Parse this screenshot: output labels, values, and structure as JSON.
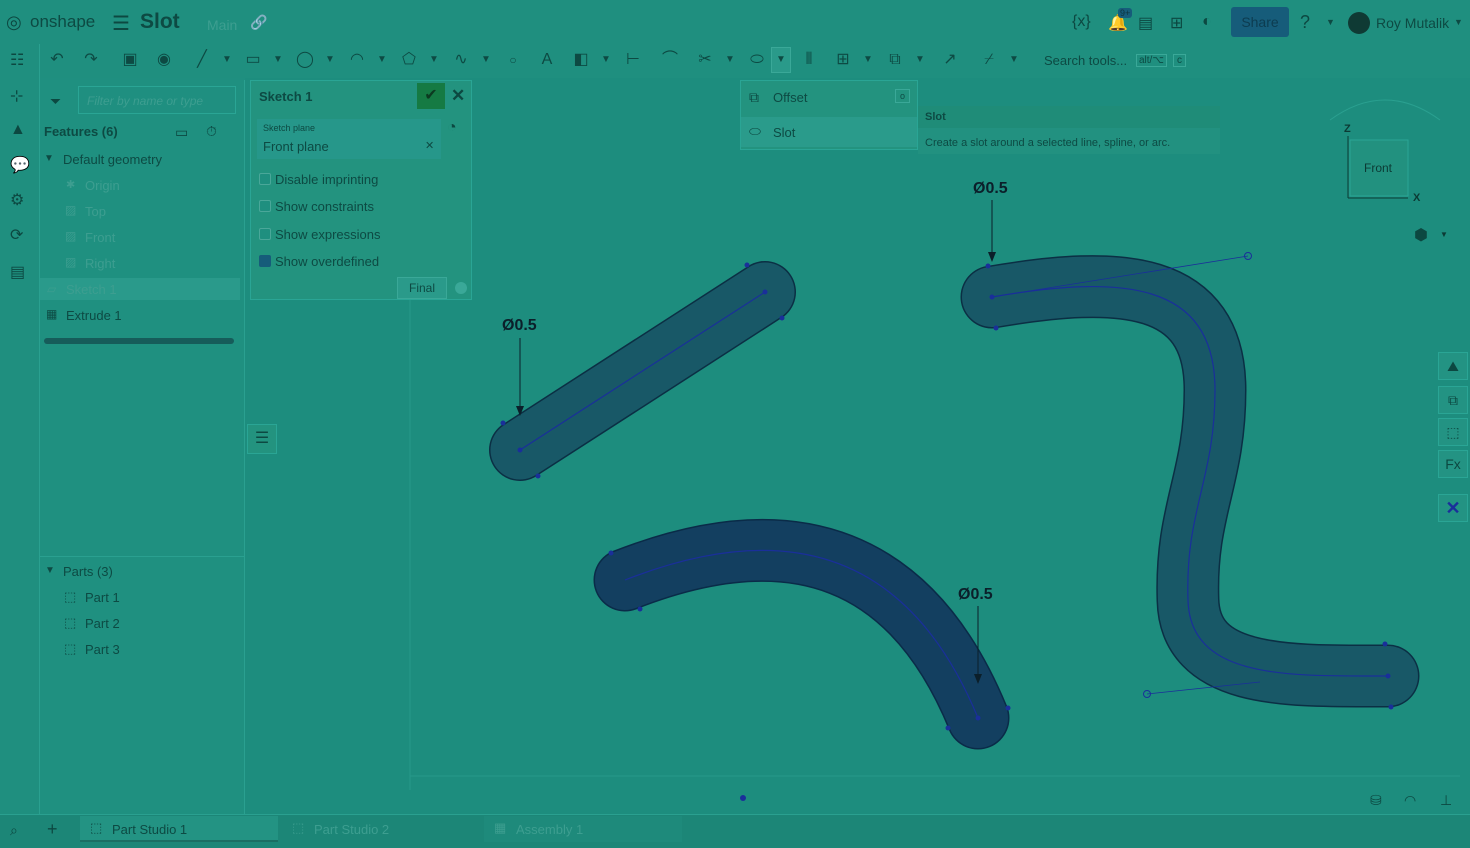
{
  "header": {
    "logo": "onshape",
    "document_title": "Slot",
    "branch": "Main",
    "share_label": "Share",
    "notification_badge": "9+",
    "user_name": "Roy Mutalik"
  },
  "toolbar": {
    "search_placeholder": "Search tools...",
    "search_shortcut_1": "alt/⌥",
    "search_shortcut_2": "c"
  },
  "feature_panel": {
    "filter_placeholder": "Filter by name or type",
    "features_heading": "Features (6)",
    "default_geometry": "Default geometry",
    "items": [
      "Origin",
      "Top",
      "Front",
      "Right",
      "Sketch 1",
      "Extrude 1"
    ],
    "parts_heading": "Parts (3)",
    "parts": [
      "Part 1",
      "Part 2",
      "Part 3"
    ]
  },
  "sketch_dialog": {
    "title": "Sketch 1",
    "plane_label": "Sketch plane",
    "plane_value": "Front plane",
    "options": [
      "Disable imprinting",
      "Show constraints",
      "Show expressions",
      "Show overdefined"
    ],
    "checked_index": 3,
    "final_label": "Final"
  },
  "dropdown": {
    "items": [
      "Offset",
      "Slot"
    ],
    "offset_shortcut": "o"
  },
  "tooltip": {
    "title": "Slot",
    "description": "Create a slot around a selected line, spline, or arc."
  },
  "viewcube": {
    "face": "Front",
    "axis_z": "Z",
    "axis_x": "X"
  },
  "dimensions": [
    "Ø0.5",
    "Ø0.5",
    "Ø0.5"
  ],
  "tabs": [
    "Part Studio 1",
    "Part Studio 2",
    "Assembly 1"
  ],
  "colors": {
    "overlay": "#1f8f80",
    "slot_fill": "#164f5e",
    "slot_fill_dark": "#0f3c5a",
    "sketch_blue": "#1a2f9a",
    "accent": "#165c7a"
  }
}
